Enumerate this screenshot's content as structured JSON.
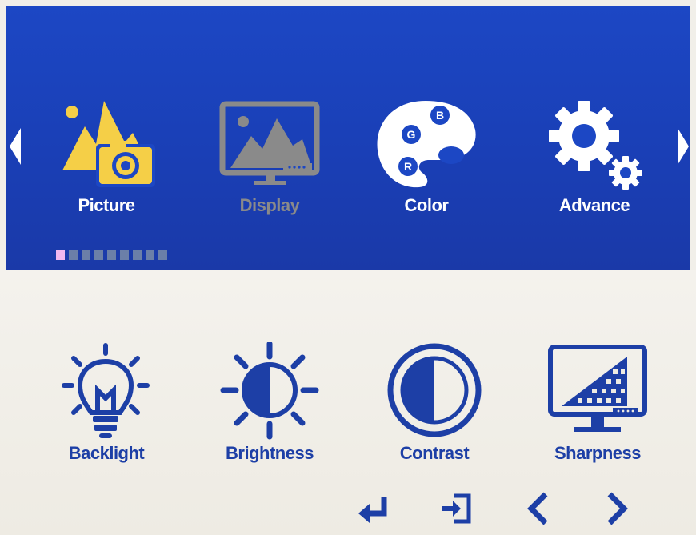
{
  "menu": {
    "items": [
      {
        "label": "Picture",
        "state": "selected",
        "icon": "picture-camera-icon"
      },
      {
        "label": "Display",
        "state": "disabled",
        "icon": "display-monitor-icon"
      },
      {
        "label": "Color",
        "state": "normal",
        "icon": "color-palette-icon"
      },
      {
        "label": "Advance",
        "state": "normal",
        "icon": "gear-icon"
      }
    ],
    "palette_letters": [
      "B",
      "G",
      "R"
    ]
  },
  "pager": {
    "total": 9,
    "current": 1
  },
  "submenu": {
    "items": [
      {
        "label": "Backlight",
        "icon": "lightbulb-icon"
      },
      {
        "label": "Brightness",
        "icon": "sun-half-icon"
      },
      {
        "label": "Contrast",
        "icon": "contrast-circle-icon"
      },
      {
        "label": "Sharpness",
        "icon": "sharpness-monitor-icon"
      }
    ]
  },
  "navigation": {
    "buttons": [
      {
        "name": "enter",
        "icon": "enter-icon"
      },
      {
        "name": "exit",
        "icon": "exit-icon"
      },
      {
        "name": "previous",
        "icon": "chevron-left-icon"
      },
      {
        "name": "next",
        "icon": "chevron-right-icon"
      }
    ]
  },
  "colors": {
    "top_background": "#1c47c4",
    "bottom_background": "#f1efe9",
    "accent_yellow": "#f5cf47",
    "accent_blue": "#1d3fa6",
    "disabled_gray": "#8a8a8a",
    "active_dot": "#f0b8f0"
  }
}
